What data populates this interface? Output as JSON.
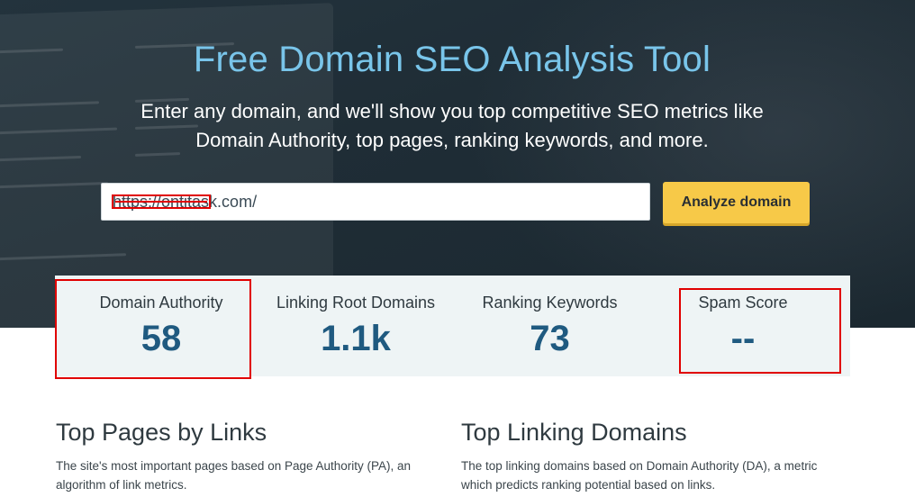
{
  "hero": {
    "title": "Free Domain SEO Analysis Tool",
    "subtitle": "Enter any domain, and we'll show you top competitive SEO metrics like Domain Authority, top pages, ranking keywords, and more."
  },
  "search": {
    "value": "https://ontitask.com/",
    "visible_suffix": "sk.com/",
    "button_label": "Analyze domain"
  },
  "metrics": [
    {
      "label": "Domain Authority",
      "value": "58"
    },
    {
      "label": "Linking Root Domains",
      "value": "1.1k"
    },
    {
      "label": "Ranking Keywords",
      "value": "73"
    },
    {
      "label": "Spam Score",
      "value": "--"
    }
  ],
  "sections": {
    "top_pages": {
      "title": "Top Pages by Links",
      "description": "The site's most important pages based on Page Authority (PA), an algorithm of link metrics."
    },
    "top_linking": {
      "title": "Top Linking Domains",
      "description": "The top linking domains based on Domain Authority (DA), a metric which predicts ranking potential based on links."
    }
  },
  "colors": {
    "hero_bg": "#1f2d36",
    "title_blue": "#79c5ea",
    "button_yellow": "#f7c948",
    "metric_value_blue": "#1f5a80",
    "metrics_panel_bg": "#eef4f5",
    "annotation_red": "#e00000"
  }
}
